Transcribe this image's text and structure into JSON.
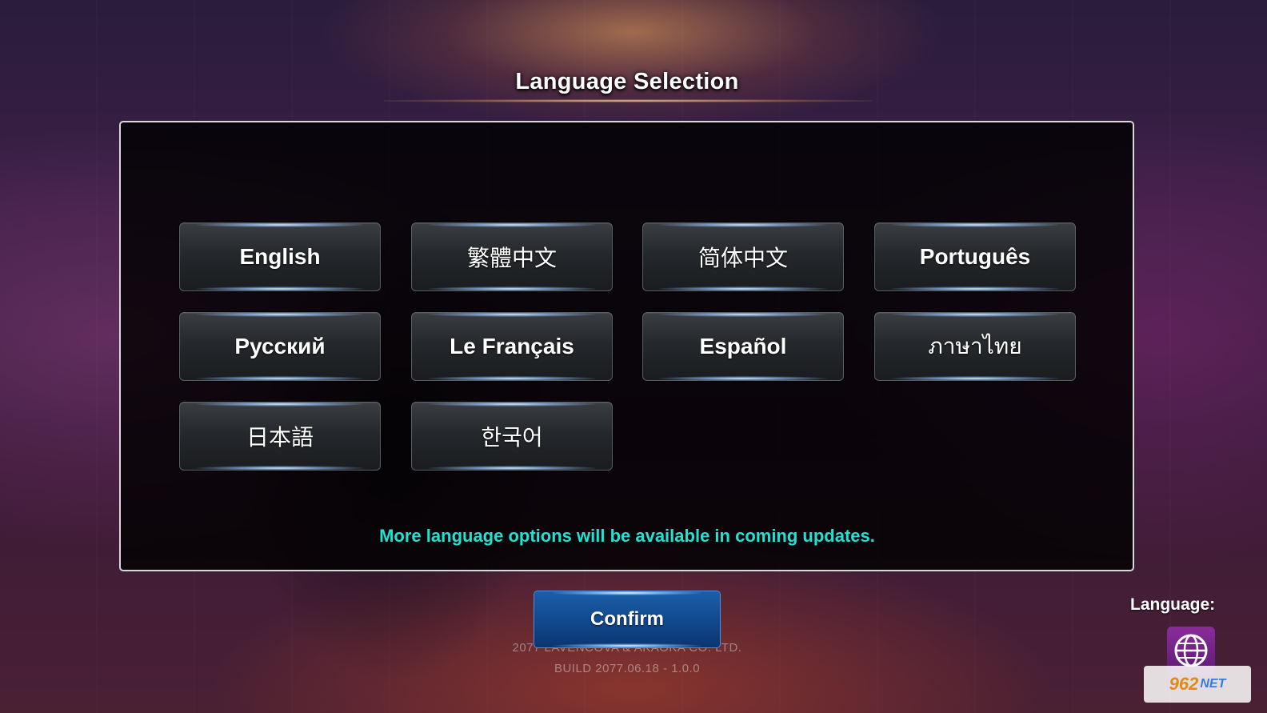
{
  "title": "Language Selection",
  "languages": [
    {
      "label": "English"
    },
    {
      "label": "繁體中文"
    },
    {
      "label": "简体中文"
    },
    {
      "label": "Português"
    },
    {
      "label": "Русский"
    },
    {
      "label": "Le Français"
    },
    {
      "label": "Español"
    },
    {
      "label": "ภาษาไทย"
    },
    {
      "label": "日本語"
    },
    {
      "label": "한국어"
    }
  ],
  "notice": "More language options will be available in coming updates.",
  "confirm_label": "Confirm",
  "footer": {
    "copyright": "2077 LAVENCOVA & AKAOKA CO. LTD.",
    "build": "BUILD 2077.06.18 - 1.0.0"
  },
  "language_indicator": {
    "label": "Language:",
    "icon": "globe-icon"
  },
  "watermark": {
    "text": "962",
    "suffix": "NET"
  },
  "colors": {
    "notice": "#22e0d2",
    "confirm": "#124a90",
    "globe_button": "#7a2690"
  }
}
